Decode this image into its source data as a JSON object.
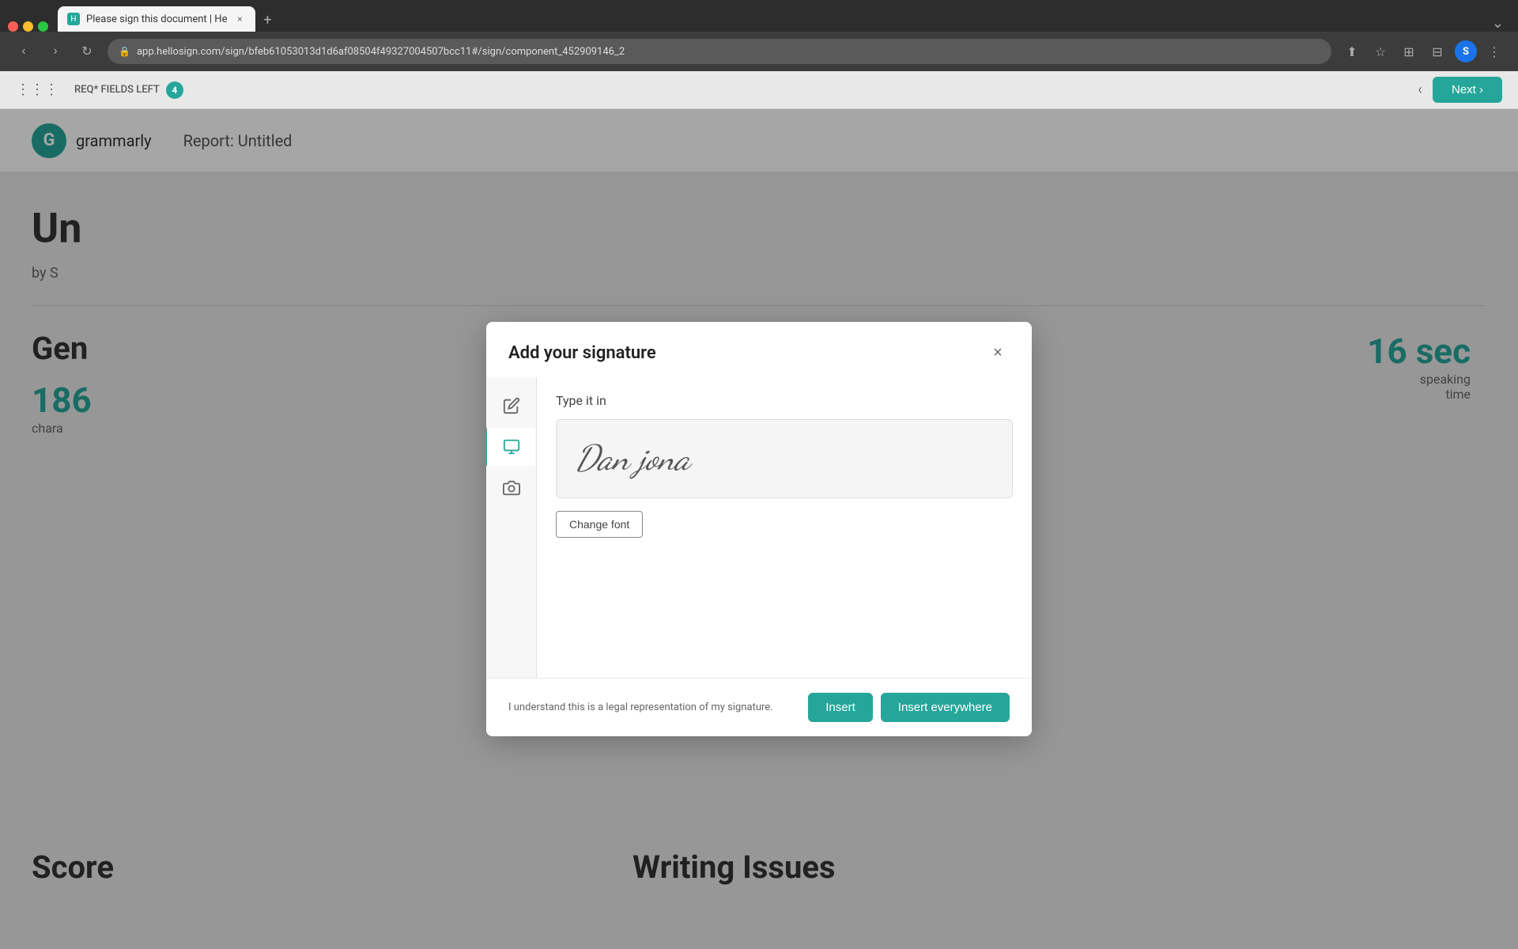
{
  "browser": {
    "traffic_lights": [
      "red",
      "yellow",
      "green"
    ],
    "tab": {
      "title": "Please sign this document | He",
      "favicon_text": "H"
    },
    "new_tab_label": "+",
    "nav": {
      "back": "‹",
      "forward": "›",
      "refresh": "↻"
    },
    "address": "app.hellosign.com/sign/bfeb61053013d1d6af08504f49327004507bcc11#/sign/component_452909146_2",
    "actions": {
      "share": "⬆",
      "bookmark": "☆",
      "extensions": "⊞",
      "sidebar": "⊟",
      "menu": "⋮",
      "profile": "S"
    }
  },
  "app_bar": {
    "fields_left_label": "REQ* FIELDS LEFT",
    "fields_count": "4",
    "nav_back": "‹",
    "next_label": "Next ›"
  },
  "background": {
    "logo_letter": "G",
    "brand_name": "grammarly",
    "report_title": "Report: Untitled",
    "heading1": "Un",
    "by_line": "by S",
    "heading2": "Gen",
    "stat1_num": "186",
    "stat1_label": "chara",
    "stat_right_num": "16 sec",
    "stat_right_label": "speaking\ntime",
    "score_label": "Score",
    "writing_issues_label": "Writing Issues"
  },
  "modal": {
    "title": "Add your signature",
    "close_icon": "×",
    "tabs": [
      {
        "id": "draw",
        "icon": "✏",
        "active": false
      },
      {
        "id": "type",
        "icon": "⌨",
        "active": true
      },
      {
        "id": "upload",
        "icon": "📷",
        "active": false
      }
    ],
    "section_label": "Type it in",
    "signature_value": "Dan jona",
    "change_font_label": "Change font",
    "footer": {
      "legal_text": "I understand this is a legal representation of my signature.",
      "insert_label": "Insert",
      "insert_everywhere_label": "Insert everywhere"
    }
  },
  "colors": {
    "accent": "#26a69a",
    "accent_dark": "#1e8a80"
  }
}
